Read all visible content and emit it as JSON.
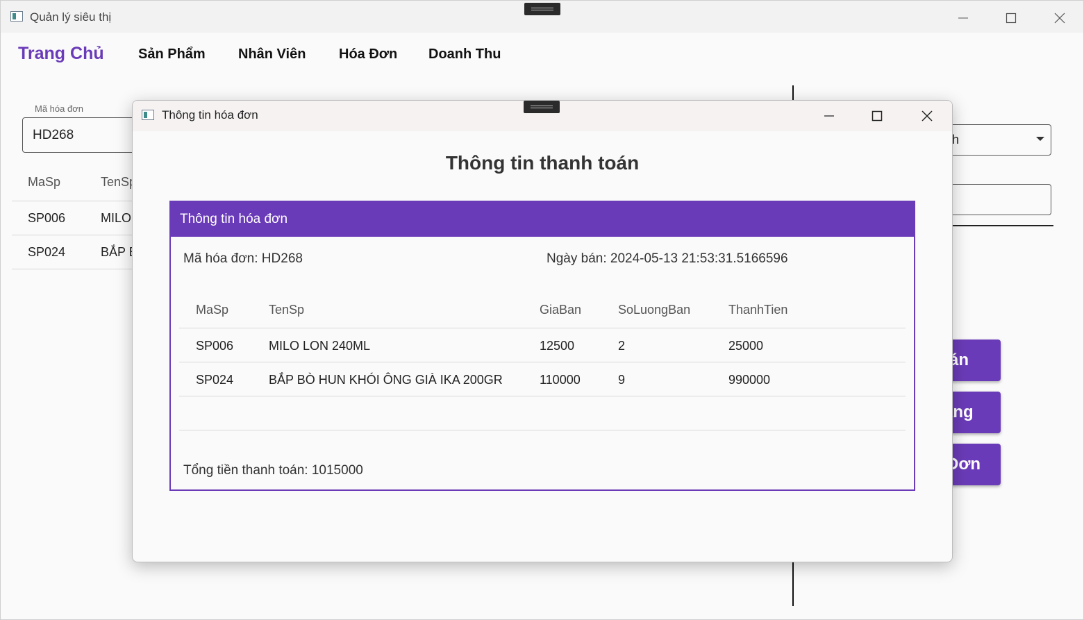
{
  "main_window": {
    "title": "Quản lý siêu thị",
    "nav": [
      "Trang Chủ",
      "Sản Phẩm",
      "Nhân Viên",
      "Hóa Đơn",
      "Doanh Thu"
    ],
    "invoice_field": {
      "label": "Mã hóa đơn",
      "value": "HD268"
    },
    "table": {
      "headers": [
        "MaSp",
        "TenSp"
      ],
      "rows": [
        [
          "SP006",
          "MILO"
        ],
        [
          "SP024",
          "BẮP E"
        ]
      ]
    },
    "select_partial": "h",
    "buttons_partial": [
      "án",
      "àng",
      "Đơn"
    ]
  },
  "dialog": {
    "title": "Thông tin hóa đơn",
    "heading": "Thông tin thanh toán",
    "card_title": "Thông tin hóa đơn",
    "invoice_id_text": "Mã hóa đơn: HD268",
    "sale_date_text": "Ngày bán: 2024-05-13 21:53:31.5166596",
    "table": {
      "headers": [
        "MaSp",
        "TenSp",
        "GiaBan",
        "SoLuongBan",
        "ThanhTien"
      ],
      "rows": [
        [
          "SP006",
          "MILO LON 240ML",
          "12500",
          "2",
          "25000"
        ],
        [
          "SP024",
          "BẮP BÒ HUN KHÓI ÔNG GIÀ IKA 200GR",
          "110000",
          "9",
          "990000"
        ]
      ]
    },
    "total_text": "Tổng tiền thanh toán: 1015000"
  },
  "colors": {
    "accent": "#6a3bb8"
  },
  "icons": [
    "app-icon",
    "minimize-icon",
    "maximize-icon",
    "close-icon",
    "dropdown-caret-icon",
    "drag-handle-icon"
  ]
}
